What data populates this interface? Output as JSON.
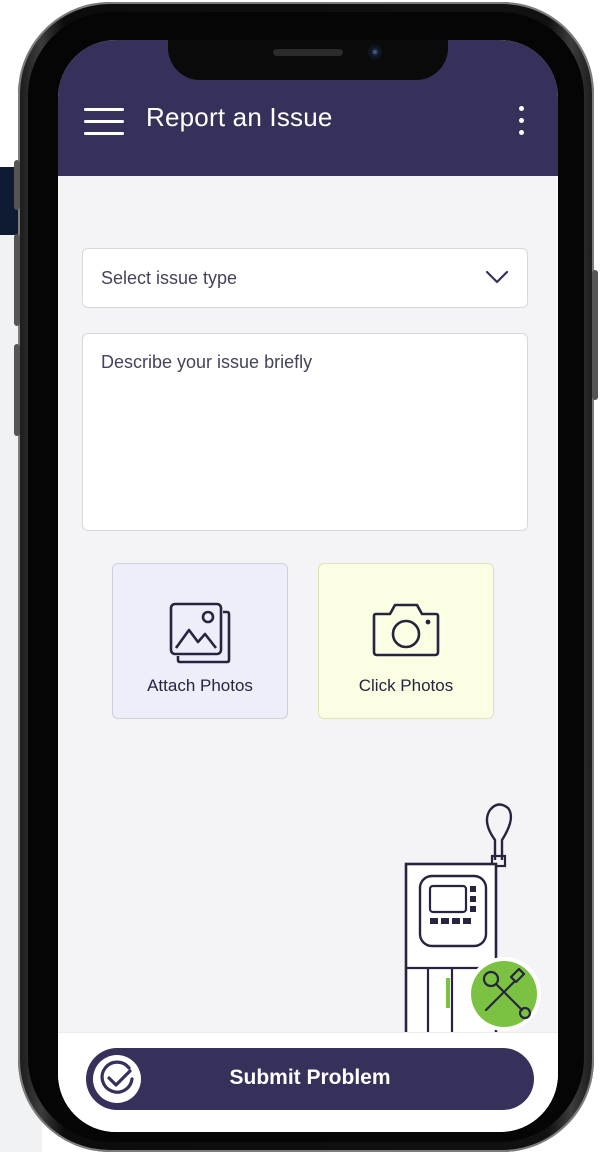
{
  "header": {
    "title": "Report an Issue",
    "menu_icon": "hamburger-menu-icon",
    "more_icon": "vertical-dots-icon"
  },
  "form": {
    "issue_type": {
      "selected_label": "Select issue type",
      "icon": "chevron-down-icon"
    },
    "description": {
      "placeholder": "Describe your issue briefly",
      "value": ""
    }
  },
  "photo_actions": {
    "attach": {
      "label": "Attach Photos",
      "icon": "image-gallery-icon",
      "color": "#eeeefb"
    },
    "click": {
      "label": "Click Photos",
      "icon": "camera-icon",
      "color": "#fbfee2"
    }
  },
  "submit": {
    "label": "Submit Problem",
    "icon": "check-circle-icon"
  },
  "illustration": {
    "name": "device-with-tools",
    "badge_color": "#7cc242"
  },
  "colors": {
    "primary": "#35315a",
    "background": "#f4f4f7",
    "accent": "#7cc242"
  }
}
